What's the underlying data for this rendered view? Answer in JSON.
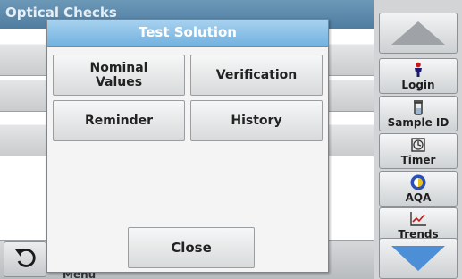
{
  "background": {
    "header_title": "Optical Checks",
    "bottom_label": "Menu"
  },
  "dialog": {
    "title": "Test Solution",
    "buttons": {
      "nominal_values": "Nominal\nValues",
      "verification": "Verification",
      "reminder": "Reminder",
      "history": "History",
      "close": "Close"
    }
  },
  "sidebar": {
    "up_arrow_icon": "triangle-up-icon",
    "down_arrow_icon": "triangle-down-icon",
    "items": [
      {
        "label": "Login",
        "icon": "person-icon"
      },
      {
        "label": "Sample ID",
        "icon": "sample-vial-icon"
      },
      {
        "label": "Timer",
        "icon": "timer-icon"
      },
      {
        "label": "AQA",
        "icon": "aqa-icon"
      },
      {
        "label": "Trends",
        "icon": "trends-chart-icon"
      }
    ]
  },
  "colors": {
    "header_blue": "#5a89ab",
    "dialog_title_blue": "#84bde6",
    "down_arrow_blue": "#4d8fd6"
  }
}
